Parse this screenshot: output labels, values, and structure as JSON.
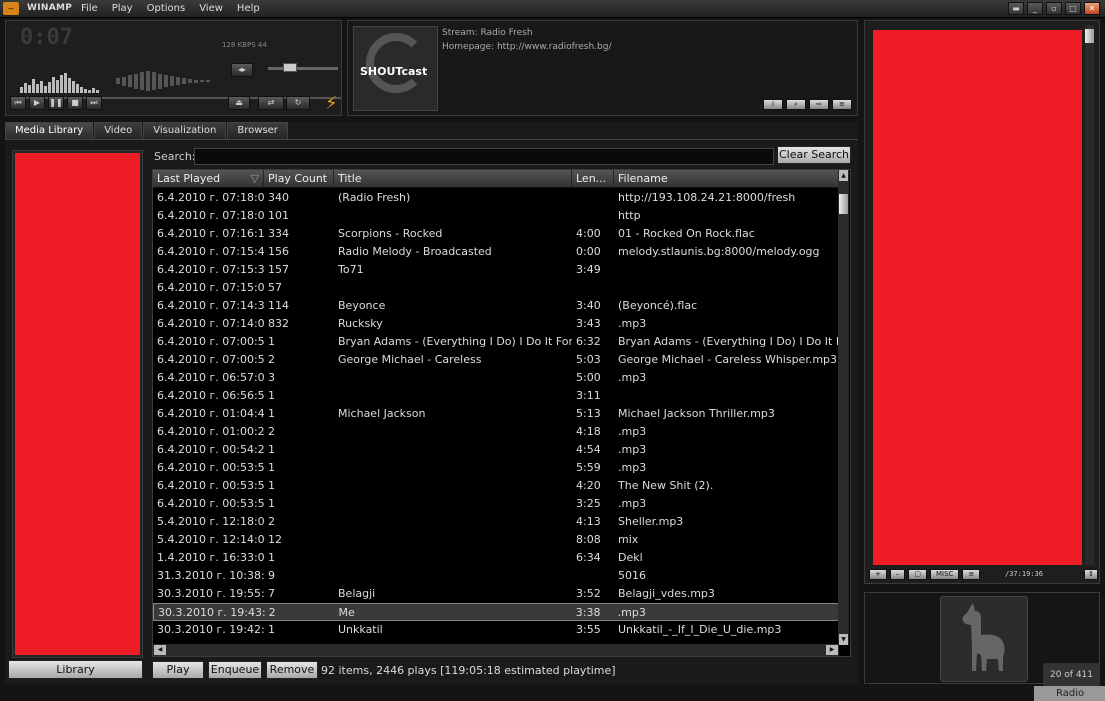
{
  "app": {
    "name": "WINAMP",
    "menu": [
      "File",
      "Play",
      "Options",
      "View",
      "Help"
    ]
  },
  "player": {
    "time": "0:07",
    "kbps": "128 KBPS",
    "khz": "44"
  },
  "shoutcast": {
    "logo": "SHOUTcast",
    "line1": "Stream: Radio Fresh",
    "line2": "Homepage: http://www.radiofresh.bg/"
  },
  "tabs": [
    "Media Library",
    "Video",
    "Visualization",
    "Browser"
  ],
  "library": {
    "button": "Library"
  },
  "search": {
    "label": "Search:",
    "value": "",
    "clear": "Clear Search"
  },
  "table": {
    "columns": [
      "Last Played",
      "Play Count",
      "Title",
      "Len...",
      "Filename"
    ],
    "rows": [
      [
        "6.4.2010 г. 07:18:0...",
        "340",
        "(Radio Fresh)",
        "",
        "http://193.108.24.21:8000/fresh"
      ],
      [
        "6.4.2010 г. 07:18:0...",
        "101",
        "",
        "",
        "http"
      ],
      [
        "6.4.2010 г. 07:16:1...",
        "334",
        "Scorpions - Rocked",
        "4:00",
        "01 - Rocked On Rock.flac"
      ],
      [
        "6.4.2010 г. 07:15:4...",
        "156",
        "Radio Melody - Broadcasted",
        "0:00",
        "melody.stlaunis.bg:8000/melody.ogg"
      ],
      [
        "6.4.2010 г. 07:15:3...",
        "157",
        "To71",
        "3:49",
        ""
      ],
      [
        "6.4.2010 г. 07:15:0...",
        "57",
        "",
        "",
        ""
      ],
      [
        "6.4.2010 г. 07:14:3...",
        "114",
        "Beyonce",
        "3:40",
        "(Beyoncé).flac"
      ],
      [
        "6.4.2010 г. 07:14:0...",
        "832",
        "Rucksky",
        "3:43",
        ".mp3"
      ],
      [
        "6.4.2010 г. 07:00:5...",
        "1",
        "Bryan Adams - (Everything I Do) I Do It For ...",
        "6:32",
        "Bryan Adams - (Everything I Do) I Do It For You"
      ],
      [
        "6.4.2010 г. 07:00:5...",
        "2",
        "George Michael - Careless",
        "5:03",
        "George Michael - Careless Whisper.mp3"
      ],
      [
        "6.4.2010 г. 06:57:0...",
        "3",
        "",
        "5:00",
        ".mp3"
      ],
      [
        "6.4.2010 г. 06:56:5...",
        "1",
        "",
        "3:11",
        ""
      ],
      [
        "6.4.2010 г. 01:04:4...",
        "1",
        "Michael Jackson",
        "5:13",
        "Michael Jackson Thriller.mp3"
      ],
      [
        "6.4.2010 г. 01:00:2...",
        "2",
        "",
        "4:18",
        ".mp3"
      ],
      [
        "6.4.2010 г. 00:54:2...",
        "1",
        "",
        "4:54",
        ".mp3"
      ],
      [
        "6.4.2010 г. 00:53:5...",
        "1",
        "",
        "5:59",
        ".mp3"
      ],
      [
        "6.4.2010 г. 00:53:5...",
        "1",
        "",
        "4:20",
        "The New Shit (2)."
      ],
      [
        "6.4.2010 г. 00:53:5...",
        "1",
        "",
        "3:25",
        ".mp3"
      ],
      [
        "5.4.2010 г. 12:18:0...",
        "2",
        "",
        "4:13",
        "Sheller.mp3"
      ],
      [
        "5.4.2010 г. 12:14:0...",
        "12",
        "",
        "8:08",
        "mix"
      ],
      [
        "1.4.2010 г. 16:33:0...",
        "1",
        "",
        "6:34",
        "Dekl"
      ],
      [
        "31.3.2010 г. 10:38:...",
        "9",
        "",
        "",
        "5016"
      ],
      [
        "30.3.2010 г. 19:55:...",
        "7",
        "Belagji",
        "3:52",
        "Belagji_vdes.mp3"
      ],
      [
        "30.3.2010 г. 19:43:...",
        "2",
        "Me",
        "3:38",
        ".mp3"
      ],
      [
        "30.3.2010 г. 19:42:...",
        "1",
        "Unkkatil",
        "3:55",
        "Unkkatil_-_If_I_Die_U_die.mp3"
      ]
    ]
  },
  "footer": {
    "play": "Play",
    "enqueue": "Enqueue",
    "remove": "Remove",
    "status": "92 items, 2446 plays [119:05:18 estimated playtime]"
  },
  "playlist": {
    "buttons": [
      "+",
      "–",
      "▢",
      "MISC",
      "≡"
    ],
    "time": "/37:19:36"
  },
  "counter": "20 of 411",
  "ghost": "Radio",
  "colors": {
    "placeholder": "#ee1c25",
    "accent": "#d8821c"
  }
}
